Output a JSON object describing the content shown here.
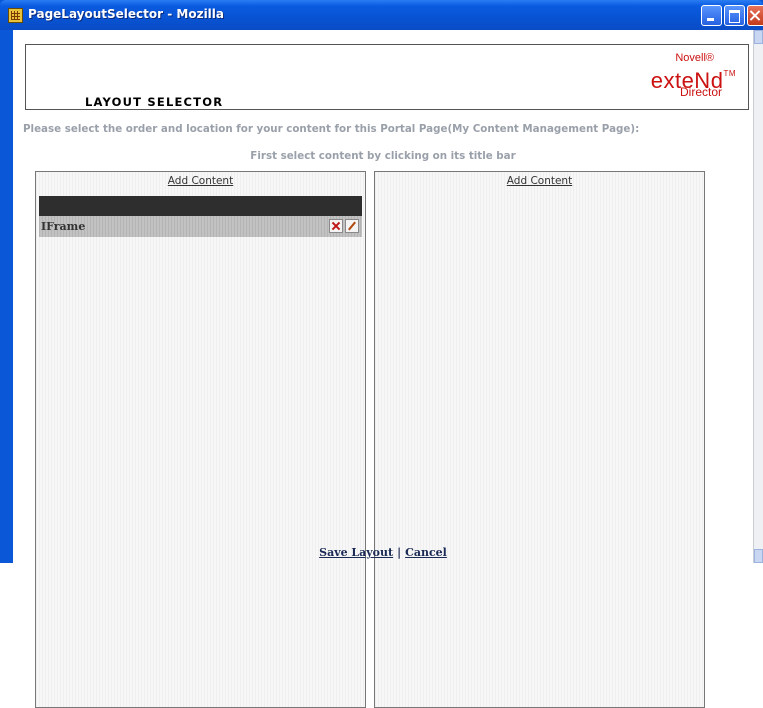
{
  "window": {
    "title": "PageLayoutSelector - Mozilla",
    "icon": "mozilla-app-icon"
  },
  "header": {
    "title": "LAYOUT SELECTOR",
    "logo": {
      "brand": "Novell®",
      "product": "exteNd",
      "trademark": "TM",
      "subproduct": "Director",
      "color": "#cc1111"
    }
  },
  "instructions": {
    "main": "Please select the order and location for your content for this Portal Page(My Content Management Page):",
    "sub": "First select content by clicking on its title bar"
  },
  "columns": [
    {
      "add_label": "Add Content",
      "portlets": [
        {
          "name": "IFrame",
          "icons": [
            "remove-icon",
            "edit-icon"
          ]
        }
      ]
    },
    {
      "add_label": "Add Content",
      "portlets": []
    }
  ],
  "footer": {
    "save_label": "Save Layout",
    "separator": "|",
    "cancel_label": "Cancel"
  }
}
